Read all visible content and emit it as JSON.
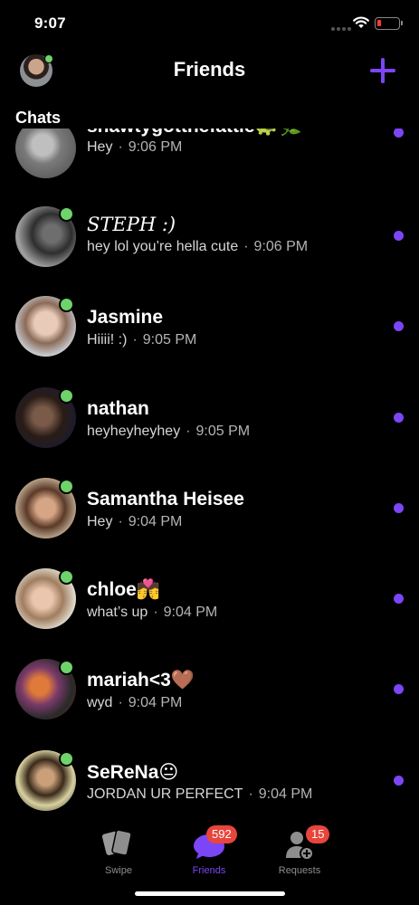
{
  "status_bar": {
    "time": "9:07"
  },
  "header": {
    "title": "Friends"
  },
  "section": {
    "title": "Chats"
  },
  "chats": [
    {
      "name": "snawtygottnefattie🐢🌿",
      "message": "Hey",
      "time": "9:06 PM",
      "online": false,
      "unread": true,
      "serif": false
    },
    {
      "name": "𝑆𝑇𝐸𝑃𝐻 :)",
      "message": "hey lol you’re hella cute",
      "time": "9:06 PM",
      "online": true,
      "unread": true,
      "serif": true
    },
    {
      "name": "Jasmine",
      "message": "Hiiii! :)",
      "time": "9:05 PM",
      "online": true,
      "unread": true,
      "serif": false
    },
    {
      "name": "nathan",
      "message": "heyheyheyhey",
      "time": "9:05 PM",
      "online": true,
      "unread": true,
      "serif": false
    },
    {
      "name": "Samantha Heisee",
      "message": "Hey",
      "time": "9:04 PM",
      "online": true,
      "unread": true,
      "serif": false
    },
    {
      "name": "chloe💏",
      "message": "what’s up",
      "time": "9:04 PM",
      "online": true,
      "unread": true,
      "serif": false
    },
    {
      "name": "mariah<3🤎",
      "message": "wyd",
      "time": "9:04 PM",
      "online": true,
      "unread": true,
      "serif": false
    },
    {
      "name": "SeReNa😐",
      "message": "JORDAN UR PERFECT",
      "time": "9:04 PM",
      "online": true,
      "unread": true,
      "serif": false
    }
  ],
  "separator": "·",
  "tabs": [
    {
      "label": "Swipe",
      "icon": "cards-icon",
      "badge": ""
    },
    {
      "label": "Friends",
      "icon": "chat-bubble-icon",
      "badge": "592"
    },
    {
      "label": "Requests",
      "icon": "add-person-icon",
      "badge": "15"
    }
  ],
  "colors": {
    "accent": "#7b46f6",
    "online": "#6fd36b",
    "badge": "#e8453c",
    "background": "#000000"
  }
}
